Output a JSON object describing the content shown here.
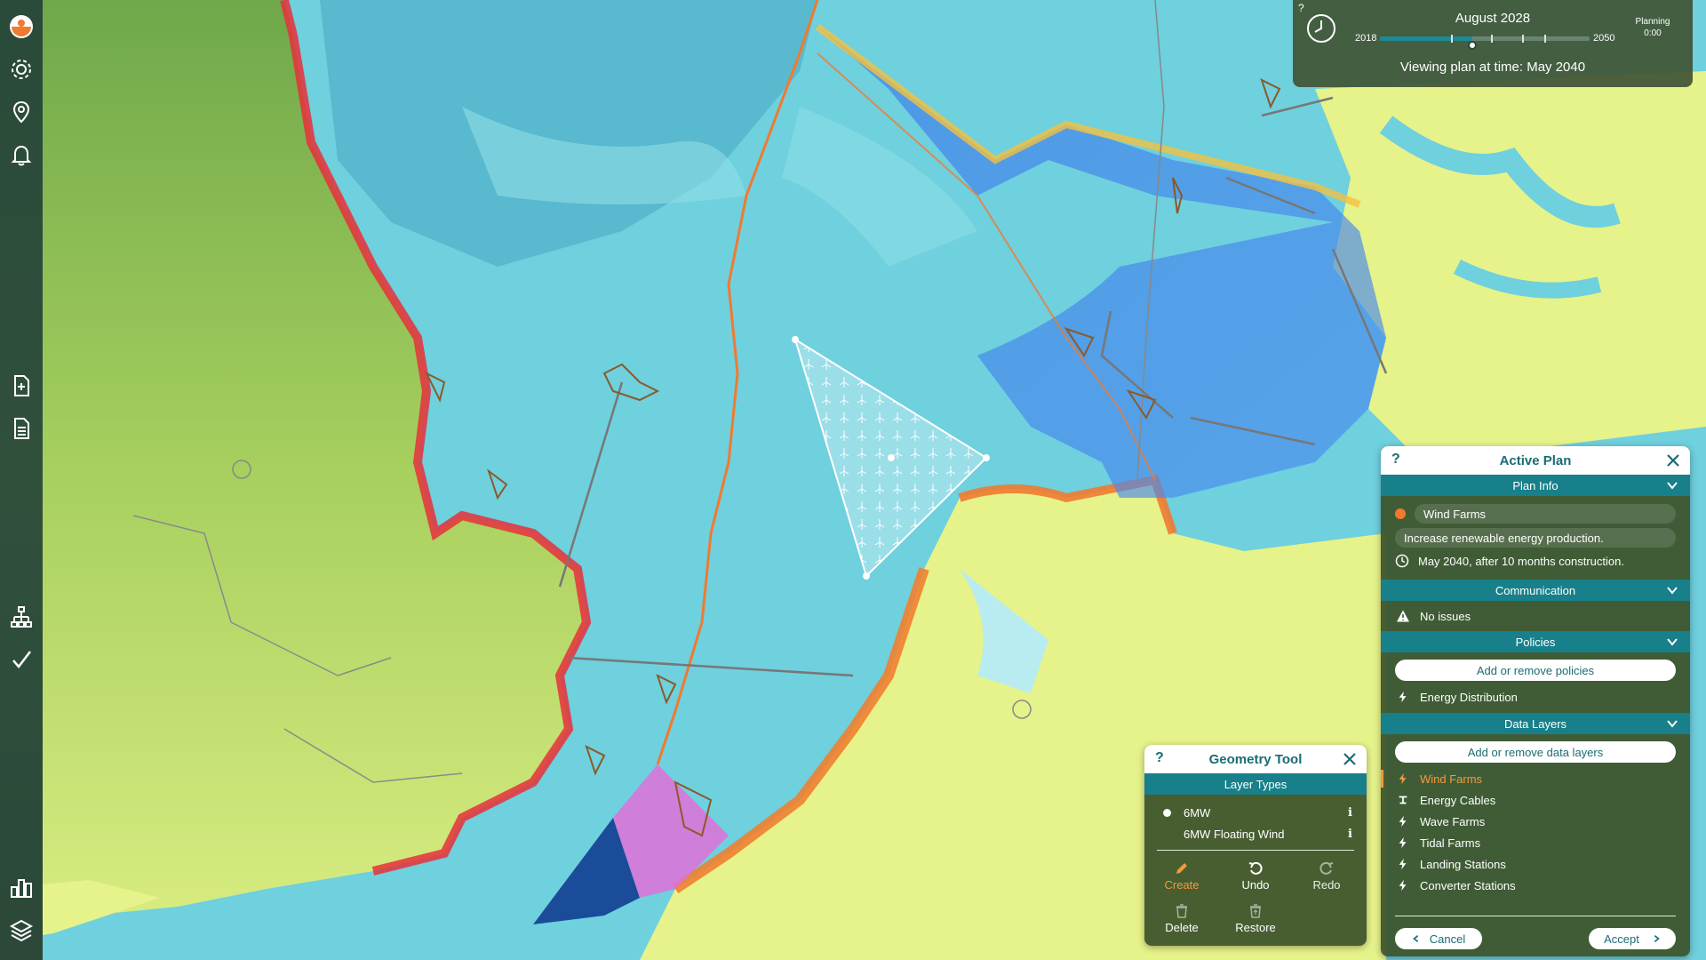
{
  "time_panel": {
    "help": "?",
    "title": "August 2028",
    "start_year": "2018",
    "end_year": "2050",
    "progress": 0.44,
    "viewing_text": "Viewing plan at time: May 2040",
    "planning_label": "Planning",
    "planning_time": "0:00"
  },
  "sidebar": {
    "items": [
      {
        "name": "logo-icon"
      },
      {
        "name": "settings-icon"
      },
      {
        "name": "location-pin-icon"
      },
      {
        "name": "bell-icon"
      },
      {
        "name": "new-plan-icon"
      },
      {
        "name": "plans-list-icon"
      },
      {
        "name": "hierarchy-icon"
      },
      {
        "name": "checkmark-icon"
      },
      {
        "name": "bar-chart-icon"
      },
      {
        "name": "layers-icon"
      }
    ]
  },
  "active_plan": {
    "help": "?",
    "title": "Active Plan",
    "sections": {
      "plan_info": "Plan Info",
      "communication": "Communication",
      "policies": "Policies",
      "data_layers": "Data Layers"
    },
    "plan_name": "Wind Farms",
    "plan_color": "#f07a30",
    "plan_description": "Increase renewable energy production.",
    "plan_time": "May 2040, after 10 months construction.",
    "communication_status": "No issues",
    "policies_button": "Add or remove policies",
    "policies": [
      "Energy Distribution"
    ],
    "data_layers_button": "Add or remove data layers",
    "data_layers": [
      "Wind Farms",
      "Energy Cables",
      "Wave Farms",
      "Tidal Farms",
      "Landing Stations",
      "Converter Stations"
    ],
    "cancel": "Cancel",
    "accept": "Accept"
  },
  "geometry_tool": {
    "help": "?",
    "title": "Geometry Tool",
    "layer_types_header": "Layer Types",
    "layer_types": [
      "6MW",
      "6MW Floating Wind"
    ],
    "create": "Create",
    "undo": "Undo",
    "redo": "Redo",
    "delete": "Delete",
    "restore": "Restore"
  },
  "colors": {
    "accent": "#17808a",
    "active": "#f39a3c",
    "panel": "#3e542c",
    "sea": "#6fd0de",
    "land": "#e6f28a"
  }
}
